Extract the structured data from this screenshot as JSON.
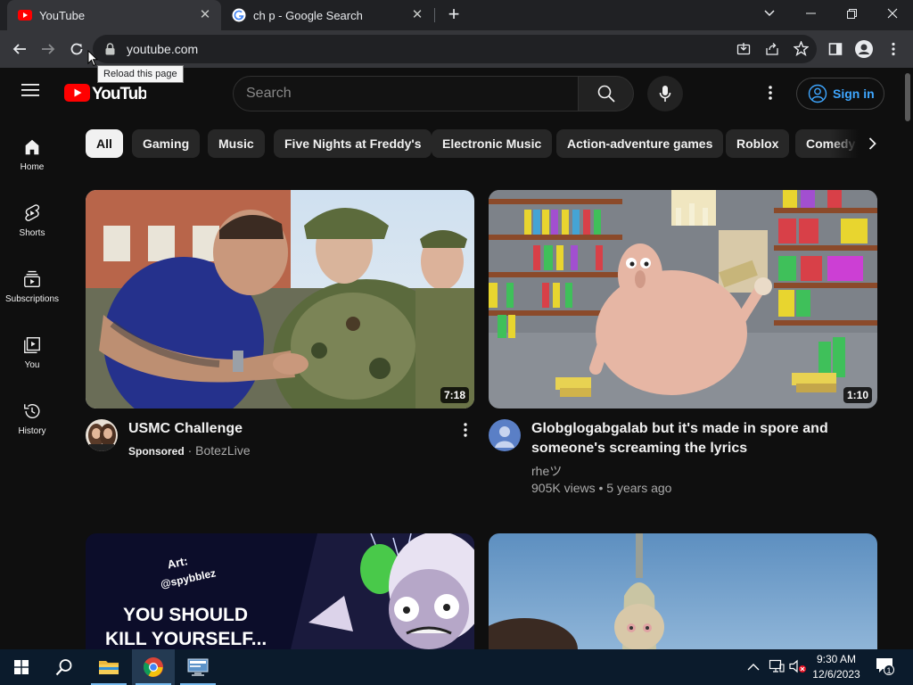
{
  "browser": {
    "tabs": [
      {
        "title": "YouTube",
        "active": true
      },
      {
        "title": "ch p - Google Search",
        "active": false
      }
    ],
    "url": "youtube.com",
    "tooltip": "Reload this page"
  },
  "youtube": {
    "search_placeholder": "Search",
    "sign_in_label": "Sign in",
    "sidebar": [
      {
        "label": "Home",
        "icon": "home-icon"
      },
      {
        "label": "Shorts",
        "icon": "shorts-icon"
      },
      {
        "label": "Subscriptions",
        "icon": "subscriptions-icon"
      },
      {
        "label": "You",
        "icon": "you-library-icon"
      },
      {
        "label": "History",
        "icon": "history-icon"
      }
    ],
    "chips": [
      "All",
      "Gaming",
      "Music",
      "Five Nights at Freddy's",
      "Electronic Music",
      "Action-adventure games",
      "Roblox",
      "Comedy"
    ],
    "videos": [
      {
        "title": "USMC Challenge",
        "sponsored_label": "Sponsored",
        "channel": "BotezLive",
        "duration": "7:18"
      },
      {
        "title_line1": "Globglogabgalab but it's made in spore and",
        "title_line2": "someone's screaming the lyrics",
        "channel": "rheツ",
        "views": "905K views",
        "age": "5 years ago",
        "duration": "1:10"
      },
      {
        "thumb_text_art": "Art:",
        "thumb_text_credit": "@spybblez",
        "thumb_text_line1": "YOU SHOULD",
        "thumb_text_line2": "KILL YOURSELF..."
      },
      {}
    ]
  },
  "taskbar": {
    "time": "9:30 AM",
    "date": "12/6/2023",
    "notification_count": "1"
  },
  "colors": {
    "youtube_red": "#ff0000",
    "link_blue": "#3ea6ff",
    "background": "#0f0f0f",
    "chip_bg": "#272727"
  }
}
